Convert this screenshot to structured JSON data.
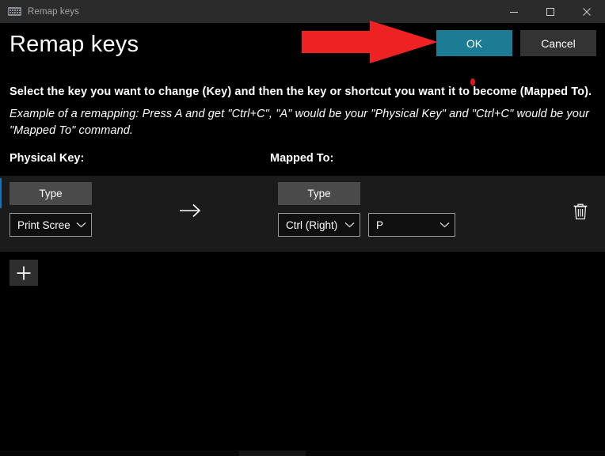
{
  "window": {
    "title": "Remap keys",
    "title_icon": "keyboard-icon",
    "controls": {
      "minimize": "minimize-icon",
      "maximize": "maximize-icon",
      "close": "close-icon"
    }
  },
  "header": {
    "page_title": "Remap keys",
    "ok_label": "OK",
    "cancel_label": "Cancel",
    "ok_color": "#1b7c94",
    "cancel_color": "#333333"
  },
  "annotation": {
    "arrow": "red-right-arrow",
    "arrow_color": "#ee2222",
    "dot_color": "#d81b1b"
  },
  "description": {
    "line1": "Select the key you want to change (Key) and then the key or shortcut you want it to become (Mapped To).",
    "line2": "Example of a remapping: Press A and get \"Ctrl+C\", \"A\" would be your \"Physical Key\" and \"Ctrl+C\" would be your \"Mapped To\" command."
  },
  "columns": {
    "physical_key": "Physical Key:",
    "mapped_to": "Mapped To:"
  },
  "rows": [
    {
      "physical": {
        "type_label": "Type",
        "key_value": "Print Scree"
      },
      "arrow_icon": "right-arrow-icon",
      "mapped": {
        "type_label": "Type",
        "key_value_1": "Ctrl (Right)",
        "key_value_2": "P"
      },
      "delete_icon": "trash-icon"
    }
  ],
  "footer": {
    "add_icon": "plus-icon"
  }
}
